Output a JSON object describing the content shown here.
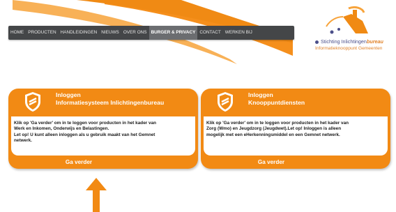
{
  "nav": {
    "items": [
      "HOME",
      "PRODUCTEN",
      "HANDLEIDINGEN",
      "NIEUWS",
      "OVER ONS",
      "BURGER & PRIVACY",
      "CONTACT",
      "WERKEN BIJ"
    ],
    "active": "BURGER & PRIVACY"
  },
  "logo": {
    "line1_prefix": "Stichting Inlichtingen",
    "line1_emph": "bureau",
    "line2": "Informatieknooppunt Gemeenten"
  },
  "cards": [
    {
      "title1": "Inloggen",
      "title2": "Informatiesysteem Inlichtingenbureau",
      "body_line1": "Klik op 'Ga verder' om in te loggen voor producten in het kader van",
      "body_line2": "Werk en Inkomen, Onderwijs en Belastingen.",
      "body_line3": "Let op! U kunt alleen inloggen als u gebruik maakt van het Gemnet",
      "body_line4": "netwerk.",
      "button": "Ga verder"
    },
    {
      "title1": "Inloggen",
      "title2": "Knooppuntdiensten",
      "body_line1": "Klik op 'Ga verder' om in te loggen voor producten in het kader van",
      "body_line2": "Zorg (Wmo) en Jeugdzorg (Jeugdwet).Let op! Inloggen is alleen",
      "body_line3": "mogelijk met een eHerkenningsmiddel en een Gemnet netwerk.",
      "body_line4": "",
      "button": "Ga verder"
    }
  ],
  "colors": {
    "orange": "#f28a14",
    "nav": "#444648",
    "brand_purple": "#4b4f8a"
  },
  "icons": {
    "card": "shield-icon",
    "pointer": "arrow-up-icon"
  }
}
